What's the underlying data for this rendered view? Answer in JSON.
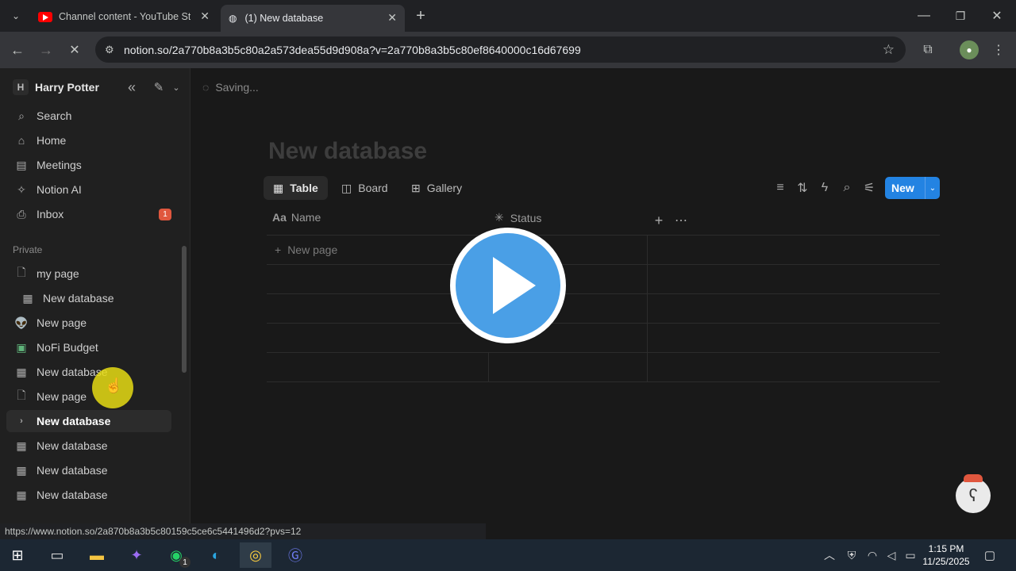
{
  "browser": {
    "tabs": [
      {
        "title": "Channel content - YouTube Studio"
      },
      {
        "title": "(1) New database"
      }
    ],
    "url": "notion.so/2a770b8a3b5c80a2a573dea55d9d908a?v=2a770b8a3b5c80ef8640000c16d67699",
    "status_url": "https://www.notion.so/2a870b8a3b5c80159c5ce6c5441496d2?pvs=12"
  },
  "sidebar": {
    "workspace_initial": "H",
    "workspace_name": "Harry Potter",
    "nav": [
      {
        "label": "Search",
        "icon": "search-icon"
      },
      {
        "label": "Home",
        "icon": "home-icon"
      },
      {
        "label": "Meetings",
        "icon": "meetings-icon"
      },
      {
        "label": "Notion AI",
        "icon": "ai-icon"
      },
      {
        "label": "Inbox",
        "icon": "inbox-icon",
        "badge": "1"
      }
    ],
    "section_label": "Private",
    "pages": [
      {
        "label": "my page",
        "icon": "page-icon"
      },
      {
        "label": "New database",
        "icon": "table-icon"
      },
      {
        "label": "New page",
        "icon": "alien-icon"
      },
      {
        "label": "NoFi Budget",
        "icon": "budget-icon"
      },
      {
        "label": "New database",
        "icon": "table-icon"
      },
      {
        "label": "New page",
        "icon": "page-icon"
      },
      {
        "label": "New database",
        "icon": "chevron-right-icon"
      },
      {
        "label": "New database",
        "icon": "table-icon"
      },
      {
        "label": "New database",
        "icon": "table-icon"
      },
      {
        "label": "New database",
        "icon": "table-icon"
      }
    ]
  },
  "topbar": {
    "saving_label": "Saving..."
  },
  "database": {
    "title": "New database",
    "views": [
      {
        "label": "Table",
        "icon": "table-icon"
      },
      {
        "label": "Board",
        "icon": "board-icon"
      },
      {
        "label": "Gallery",
        "icon": "gallery-icon"
      }
    ],
    "new_button_label": "New",
    "columns": [
      {
        "label": "Name",
        "icon": "text-property-icon"
      },
      {
        "label": "Status",
        "icon": "status-property-icon"
      }
    ],
    "new_page_label": "New page"
  },
  "taskbar": {
    "time": "1:15 PM",
    "date": "11/25/2025",
    "whatsapp_badge": "1"
  },
  "colors": {
    "accent": "#2383e2",
    "play": "#4a9fe6",
    "badge": "#e0573e"
  }
}
